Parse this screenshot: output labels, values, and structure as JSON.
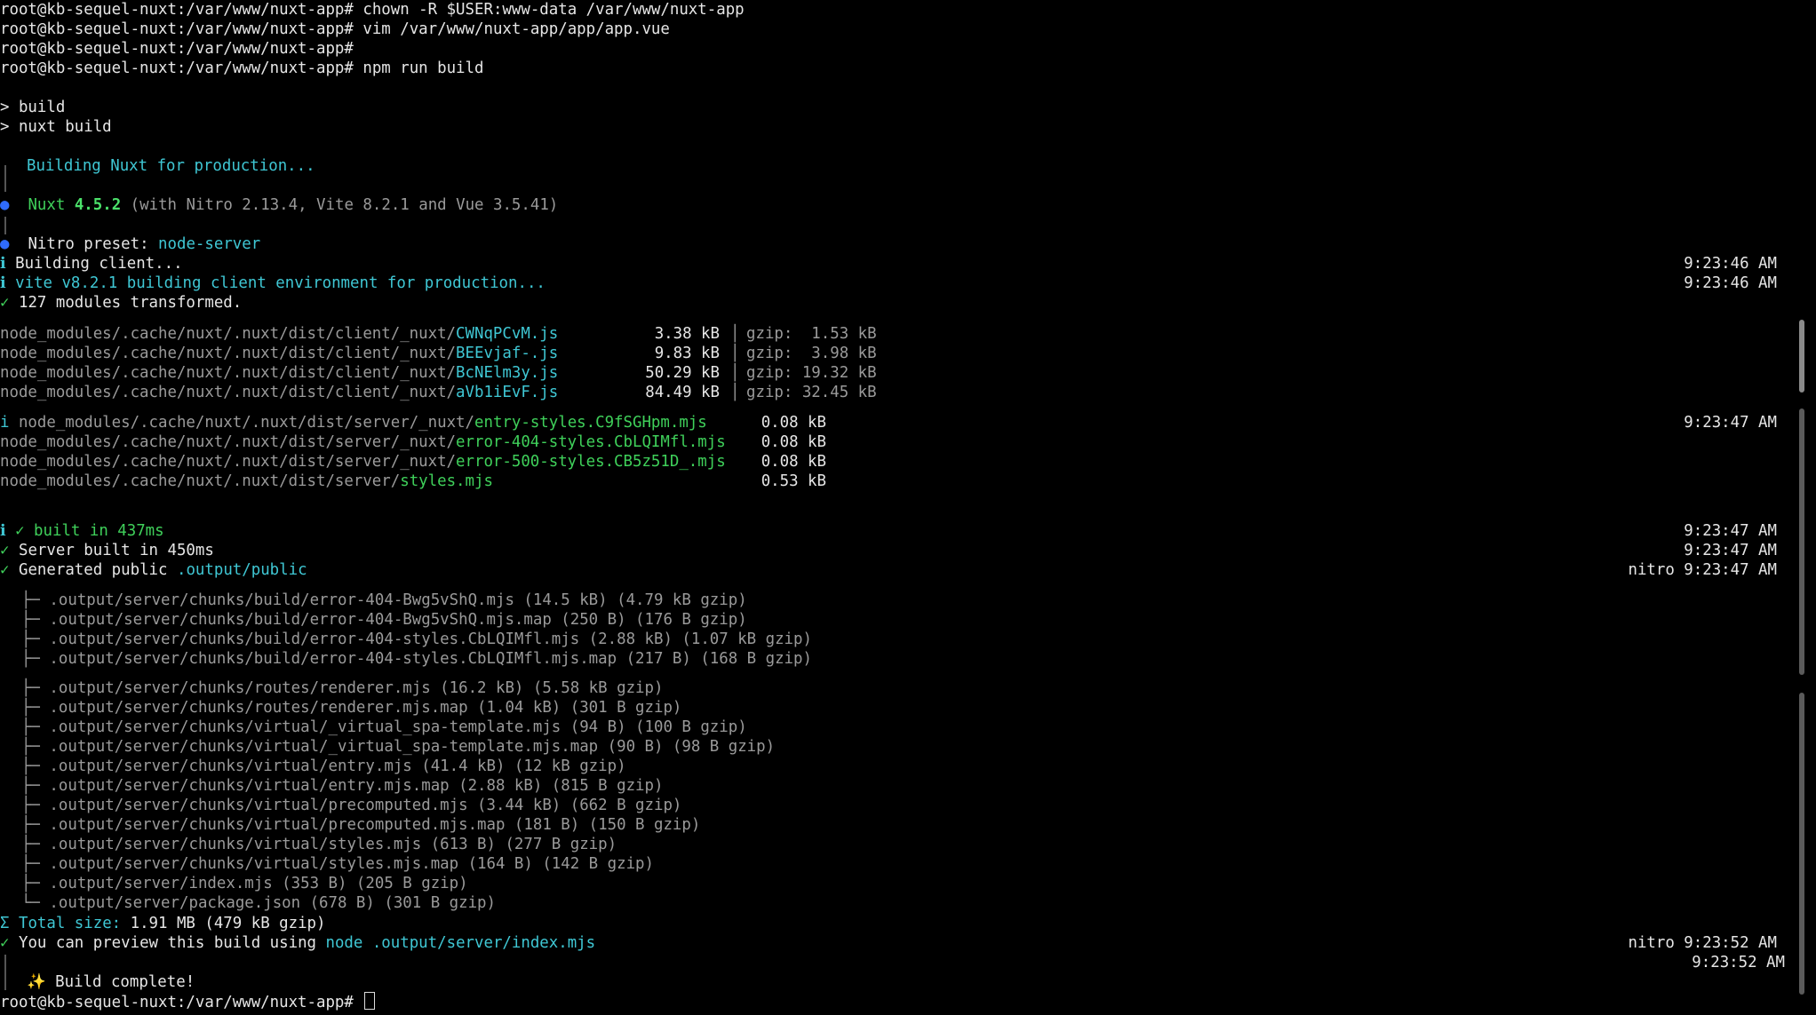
{
  "prompt": "root@kb-sequel-nuxt:/var/www/nuxt-app#",
  "commands": [
    "chown -R $USER:www-data /var/www/nuxt-app",
    "vim /var/www/nuxt-app/app/app.vue",
    "",
    "npm run build"
  ],
  "npm": {
    "line1": "> build",
    "line2": "> nuxt build"
  },
  "nuxt": {
    "building": "Building Nuxt for production...",
    "name": "Nuxt",
    "version": "4.5.2",
    "with": "(with Nitro 2.13.4, Vite 8.2.1 and Vue 3.5.41)",
    "preset_label": "Nitro preset: ",
    "preset_value": "node-server"
  },
  "client": {
    "building": "Building client...",
    "vite": "vite v8.2.1 building client environment for production...",
    "modules": "127 modules transformed.",
    "time1": "9:23:46 AM",
    "time2": "9:23:46 AM",
    "files": [
      {
        "dir": "node_modules/.cache/nuxt/.nuxt/dist/client/_nuxt/",
        "file": "CWNqPCvM.js",
        "size": "3.38 kB",
        "gzip": "gzip:  1.53 kB"
      },
      {
        "dir": "node_modules/.cache/nuxt/.nuxt/dist/client/_nuxt/",
        "file": "BEEvjaf-.js",
        "size": "9.83 kB",
        "gzip": "gzip:  3.98 kB"
      },
      {
        "dir": "node_modules/.cache/nuxt/.nuxt/dist/client/_nuxt/",
        "file": "BcNElm3y.js",
        "size": "50.29 kB",
        "gzip": "gzip: 19.32 kB"
      },
      {
        "dir": "node_modules/.cache/nuxt/.nuxt/dist/client/_nuxt/",
        "file": "aVb1iEvF.js",
        "size": "84.49 kB",
        "gzip": "gzip: 32.45 kB"
      }
    ]
  },
  "server_files": {
    "time": "9:23:47 AM",
    "files": [
      {
        "prefix": "i ",
        "dir": "node_modules/.cache/nuxt/.nuxt/dist/server/_nuxt/",
        "file": "entry-styles.C9fSGHpm.mjs",
        "size": "0.08 kB"
      },
      {
        "prefix": "",
        "dir": "node_modules/.cache/nuxt/.nuxt/dist/server/_nuxt/",
        "file": "error-404-styles.CbLQIMfl.mjs",
        "size": "0.08 kB"
      },
      {
        "prefix": "",
        "dir": "node_modules/.cache/nuxt/.nuxt/dist/server/_nuxt/",
        "file": "error-500-styles.CB5z51D_.mjs",
        "size": "0.08 kB"
      },
      {
        "prefix": "",
        "dir": "node_modules/.cache/nuxt/.nuxt/dist/server/",
        "file": "styles.mjs",
        "size": "0.53 kB"
      }
    ]
  },
  "results": {
    "built": "✓ built in 437ms",
    "server": "Server built in 450ms",
    "generated_label": "Generated public ",
    "generated_path": ".output/public",
    "time1": "9:23:47 AM",
    "time2": "9:23:47 AM",
    "time3": "nitro 9:23:47 AM"
  },
  "outputs": [
    ".output/server/chunks/build/error-404-Bwg5vShQ.mjs (14.5 kB) (4.79 kB gzip)",
    ".output/server/chunks/build/error-404-Bwg5vShQ.mjs.map (250 B) (176 B gzip)",
    ".output/server/chunks/build/error-404-styles.CbLQIMfl.mjs (2.88 kB) (1.07 kB gzip)",
    ".output/server/chunks/build/error-404-styles.CbLQIMfl.mjs.map (217 B) (168 B gzip)",
    ".output/server/chunks/routes/renderer.mjs (16.2 kB) (5.58 kB gzip)",
    ".output/server/chunks/routes/renderer.mjs.map (1.04 kB) (301 B gzip)",
    ".output/server/chunks/virtual/_virtual_spa-template.mjs (94 B) (100 B gzip)",
    ".output/server/chunks/virtual/_virtual_spa-template.mjs.map (90 B) (98 B gzip)",
    ".output/server/chunks/virtual/entry.mjs (41.4 kB) (12 kB gzip)",
    ".output/server/chunks/virtual/entry.mjs.map (2.88 kB) (815 B gzip)",
    ".output/server/chunks/virtual/precomputed.mjs (3.44 kB) (662 B gzip)",
    ".output/server/chunks/virtual/precomputed.mjs.map (181 B) (150 B gzip)",
    ".output/server/chunks/virtual/styles.mjs (613 B) (277 B gzip)",
    ".output/server/chunks/virtual/styles.mjs.map (164 B) (142 B gzip)",
    ".output/server/index.mjs (353 B) (205 B gzip)",
    ".output/server/package.json (678 B) (301 B gzip)"
  ],
  "total": {
    "label": "Total size: ",
    "value": "1.91 MB (479 kB gzip)"
  },
  "preview": {
    "label": "You can preview this build using ",
    "cmd": "node .output/server/index.mjs",
    "time": "nitro 9:23:52 AM"
  },
  "complete": {
    "text": "✨ Build complete!",
    "time": "9:23:52 AM"
  }
}
